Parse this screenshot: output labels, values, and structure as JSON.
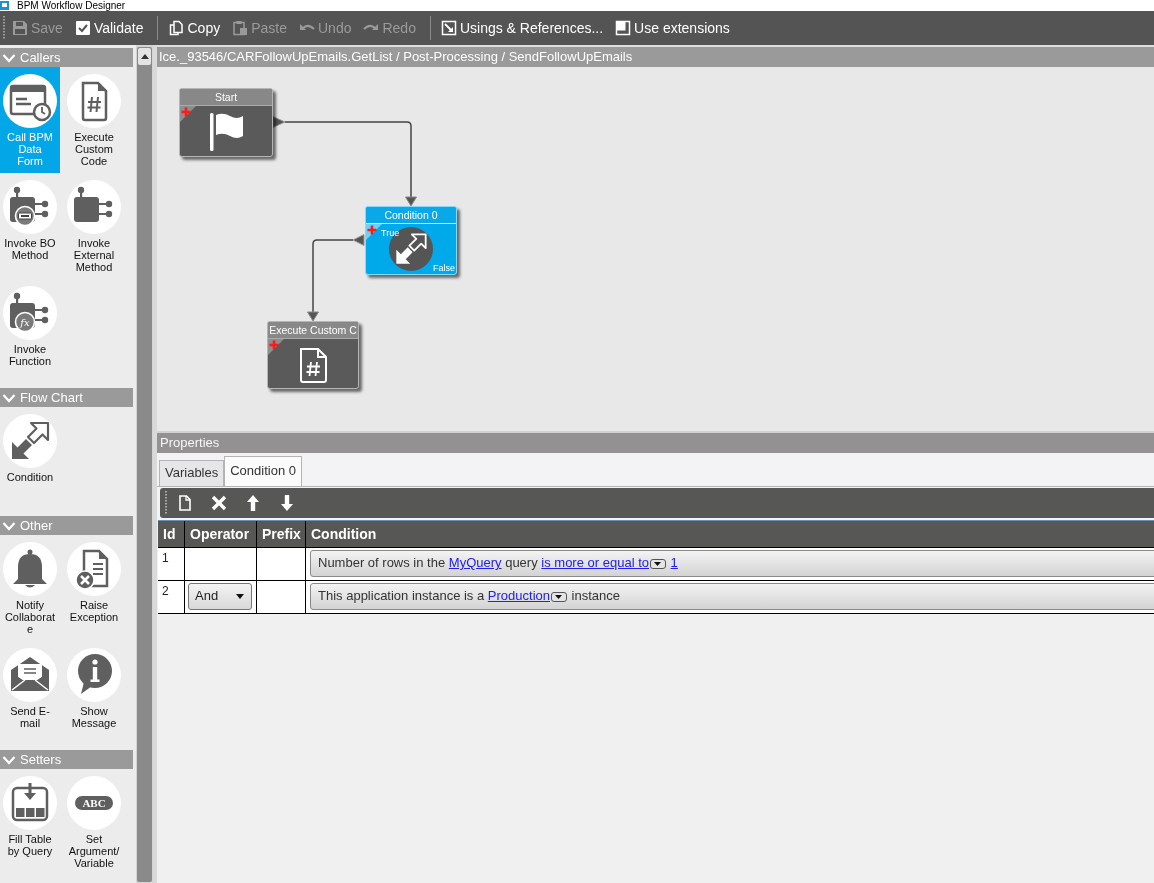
{
  "window": {
    "title": "BPM Workflow Designer"
  },
  "toolbar": {
    "groups": [
      [
        {
          "label": "Save",
          "disabled": true
        },
        {
          "label": "Validate",
          "disabled": false
        }
      ],
      [
        {
          "label": "Copy",
          "disabled": false
        },
        {
          "label": "Paste",
          "disabled": true
        },
        {
          "label": "Undo",
          "disabled": true
        },
        {
          "label": "Redo",
          "disabled": true
        }
      ],
      [
        {
          "label": "Usings & References...",
          "disabled": false
        },
        {
          "label": "Use extensions",
          "disabled": false
        }
      ]
    ]
  },
  "palette": {
    "sections": [
      {
        "title": "Callers",
        "expanded": true,
        "items": [
          {
            "label": "Call BPM Data Form",
            "selected": true
          },
          {
            "label": "Execute Custom Code",
            "selected": false
          },
          {
            "label": "Invoke BO Method",
            "selected": false
          },
          {
            "label": "Invoke External Method",
            "selected": false
          },
          {
            "label": "Invoke Function",
            "selected": false,
            "icon_text": "fx"
          }
        ]
      },
      {
        "title": "Flow Chart",
        "expanded": true,
        "items": [
          {
            "label": "Condition",
            "selected": false
          }
        ]
      },
      {
        "title": "Other",
        "expanded": true,
        "items": [
          {
            "label": "Notify Collaborate",
            "selected": false
          },
          {
            "label": "Raise Exception",
            "selected": false
          },
          {
            "label": "Send E-mail",
            "selected": false
          },
          {
            "label": "Show Message",
            "selected": false
          }
        ]
      },
      {
        "title": "Setters",
        "expanded": true,
        "items": [
          {
            "label": "Fill Table by Query",
            "selected": false
          },
          {
            "label": "Set Argument/Variable",
            "selected": false,
            "icon_text": "ABC"
          }
        ]
      }
    ]
  },
  "breadcrumb": "Ice._93546/CARFollowUpEmails.GetList / Post-Processing / SendFollowUpEmails",
  "canvas": {
    "nodes": [
      {
        "title": "Start",
        "kind": "start",
        "selected": false
      },
      {
        "title": "Condition 0",
        "kind": "condition",
        "selected": true,
        "true_label": "True",
        "false_label": "False"
      },
      {
        "title": "Execute Custom C",
        "kind": "custom-code",
        "selected": false
      }
    ]
  },
  "properties": {
    "title": "Properties",
    "tabs": [
      {
        "label": "Variables",
        "selected": false
      },
      {
        "label": "Condition 0",
        "selected": true
      }
    ],
    "table": {
      "columns": [
        "Id",
        "Operator",
        "Prefix",
        "Condition"
      ],
      "rows": [
        {
          "id": "1",
          "condition": [
            {
              "kind": "text",
              "text": "Number of rows in the"
            },
            {
              "kind": "link",
              "text": "MyQuery"
            },
            {
              "kind": "text",
              "text": "query"
            },
            {
              "kind": "link",
              "text": "is more or equal to"
            },
            {
              "kind": "dropdown"
            },
            {
              "kind": "link",
              "text": "1"
            }
          ]
        },
        {
          "id": "2",
          "operator": "And",
          "condition": [
            {
              "kind": "text",
              "text": "This application instance is a"
            },
            {
              "kind": "link",
              "text": "Production"
            },
            {
              "kind": "dropdown"
            },
            {
              "kind": "text",
              "text": "instance"
            }
          ]
        }
      ]
    }
  }
}
